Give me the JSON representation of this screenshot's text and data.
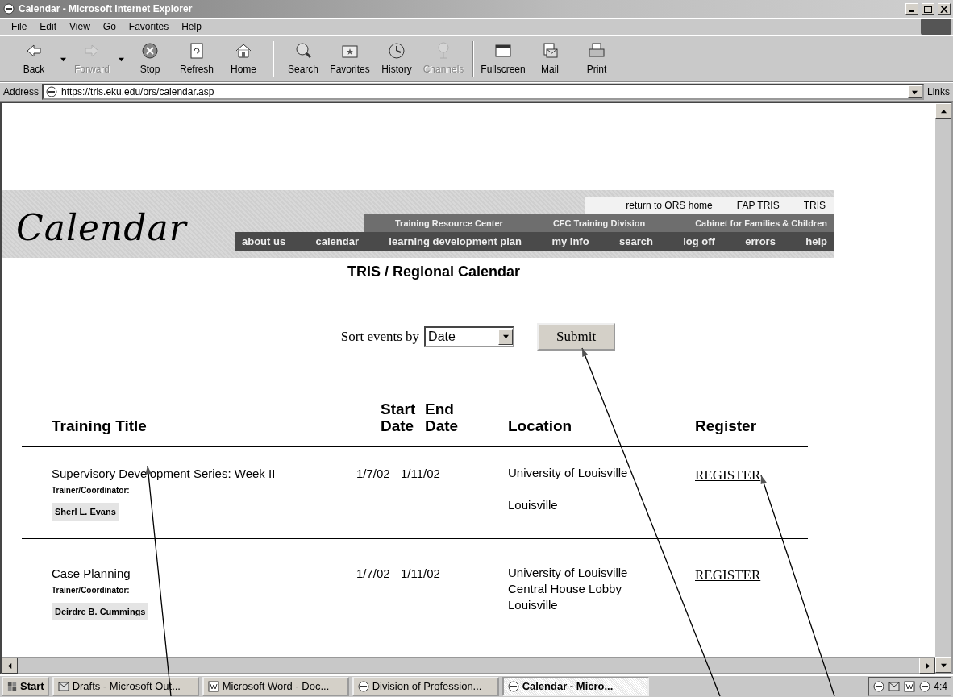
{
  "window": {
    "title": "Calendar - Microsoft Internet Explorer"
  },
  "menu": [
    "File",
    "Edit",
    "View",
    "Go",
    "Favorites",
    "Help"
  ],
  "toolbar": [
    {
      "label": "Back",
      "disabled": false,
      "dropdown": true
    },
    {
      "label": "Forward",
      "disabled": true,
      "dropdown": true
    },
    {
      "label": "Stop",
      "disabled": false,
      "dropdown": false
    },
    {
      "label": "Refresh",
      "disabled": false,
      "dropdown": false
    },
    {
      "label": "Home",
      "disabled": false,
      "dropdown": false
    },
    {
      "label": "Search",
      "disabled": false,
      "dropdown": false
    },
    {
      "label": "Favorites",
      "disabled": false,
      "dropdown": false
    },
    {
      "label": "History",
      "disabled": false,
      "dropdown": false
    },
    {
      "label": "Channels",
      "disabled": true,
      "dropdown": false
    },
    {
      "label": "Fullscreen",
      "disabled": false,
      "dropdown": false
    },
    {
      "label": "Mail",
      "disabled": false,
      "dropdown": false
    },
    {
      "label": "Print",
      "disabled": false,
      "dropdown": false
    }
  ],
  "address": {
    "label": "Address",
    "value": "https://tris.eku.edu/ors/calendar.asp",
    "links": "Links"
  },
  "page": {
    "logo": "Calendar",
    "top_links": [
      "return to ORS home",
      "FAP TRIS",
      "TRIS"
    ],
    "division_links": [
      "Training Resource Center",
      "CFC Training Division",
      "Cabinet for Families & Children"
    ],
    "nav_links": [
      "about us",
      "calendar",
      "learning development plan",
      "my info",
      "search",
      "log off",
      "errors",
      "help"
    ],
    "heading": "TRIS / Regional Calendar",
    "sort": {
      "label": "Sort events by",
      "value": "Date",
      "button": "Submit"
    },
    "table": {
      "columns": [
        "Training Title",
        "Start Date",
        "End Date",
        "Location",
        "Register"
      ],
      "rows": [
        {
          "title": "Supervisory Development Series: Week II",
          "trainer_label": "Trainer/Coordinator:",
          "trainer": "Sherl L. Evans",
          "start": "1/7/02",
          "end": "1/11/02",
          "venue": "University of Louisville",
          "city": "Louisville",
          "register": "REGISTER"
        },
        {
          "title": "Case Planning",
          "trainer_label": "Trainer/Coordinator:",
          "trainer": "Deirdre B. Cummings",
          "start": "1/7/02",
          "end": "1/11/02",
          "venue": "University of Louisville",
          "room": "Central House Lobby",
          "city": "Louisville",
          "register": "REGISTER"
        }
      ]
    }
  },
  "taskbar": {
    "start": "Start",
    "items": [
      {
        "label": "Drafts - Microsoft Out...",
        "selected": false
      },
      {
        "label": "Microsoft Word - Doc...",
        "selected": false
      },
      {
        "label": "Division of Profession...",
        "selected": false
      },
      {
        "label": "Calendar - Micro...",
        "selected": true
      }
    ],
    "clock": "4:4"
  }
}
